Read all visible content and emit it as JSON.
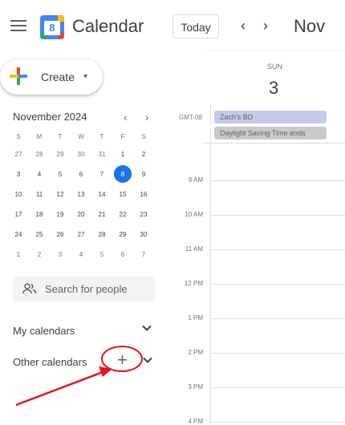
{
  "header": {
    "app_title": "Calendar",
    "logo_day": "8",
    "today_label": "Today",
    "prev_symbol": "‹",
    "next_symbol": "›",
    "month_title": "Nov"
  },
  "create": {
    "label": "Create",
    "caret": "▾"
  },
  "mini_calendar": {
    "title": "November 2024",
    "prev_symbol": "‹",
    "next_symbol": "›",
    "weekday_headers": [
      "S",
      "M",
      "T",
      "W",
      "T",
      "F",
      "S"
    ],
    "weeks": [
      [
        "27",
        "28",
        "29",
        "30",
        "31",
        "1",
        "2"
      ],
      [
        "3",
        "4",
        "5",
        "6",
        "7",
        "8",
        "9"
      ],
      [
        "10",
        "11",
        "12",
        "13",
        "14",
        "15",
        "16"
      ],
      [
        "17",
        "18",
        "19",
        "20",
        "21",
        "22",
        "23"
      ],
      [
        "24",
        "25",
        "26",
        "27",
        "28",
        "29",
        "30"
      ],
      [
        "1",
        "2",
        "3",
        "4",
        "5",
        "6",
        "7"
      ]
    ],
    "today": "8"
  },
  "people_search": {
    "placeholder": "Search for people"
  },
  "sidebar": {
    "my_calendars": "My calendars",
    "other_calendars": "Other calendars",
    "add_symbol": "+",
    "chevron": "⌄"
  },
  "day_view": {
    "weekday": "SUN",
    "day_number": "3",
    "timezone": "GMT-08",
    "all_day_events": [
      "Zach's BD",
      "Daylight Saving Time ends"
    ],
    "hours": [
      "9 AM",
      "10 AM",
      "11 AM",
      "12 PM",
      "1 PM",
      "2 PM",
      "3 PM",
      "4 PM"
    ]
  },
  "colors": {
    "accent": "#1a73e8",
    "annotation_red": "#e8101a",
    "event_birthday": "#c5cae9",
    "event_holiday": "#c8cacb"
  },
  "icons": [
    "menu-icon",
    "calendar-logo-icon",
    "chevron-left-icon",
    "chevron-right-icon",
    "plus-icon",
    "caret-down-icon",
    "people-icon",
    "chevron-down-icon",
    "add-icon"
  ]
}
